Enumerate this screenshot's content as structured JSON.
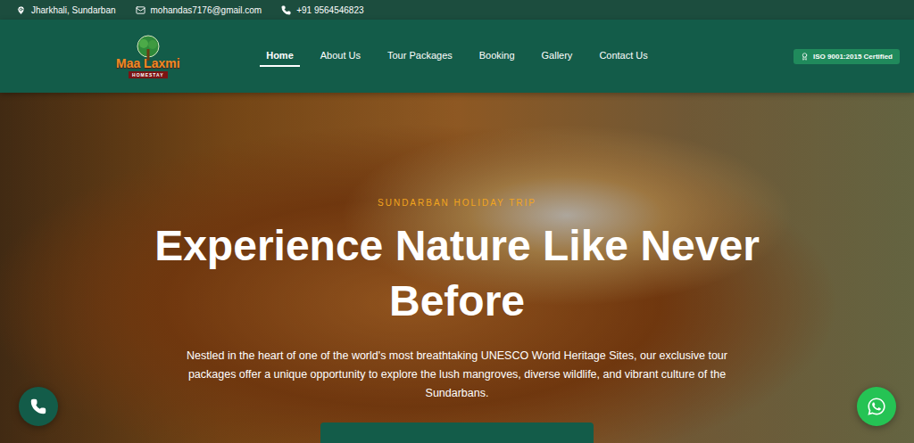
{
  "topbar": {
    "location": "Jharkhali, Sundarban",
    "email": "mohandas7176@gmail.com",
    "phone": "+91 9564546823"
  },
  "logo": {
    "name": "Maa Laxmi",
    "tagline": "HOMESTAY"
  },
  "nav": [
    {
      "label": "Home",
      "selected": true
    },
    {
      "label": "About Us",
      "selected": false
    },
    {
      "label": "Tour Packages",
      "selected": false
    },
    {
      "label": "Booking",
      "selected": false
    },
    {
      "label": "Gallery",
      "selected": false
    },
    {
      "label": "Contact Us",
      "selected": false
    }
  ],
  "badge": "ISO 9001:2015 Certified",
  "hero": {
    "eyebrow": "SUNDARBAN HOLIDAY TRIP",
    "title": "Experience Nature Like Never Before",
    "text": "Nestled in the heart of one of the world's most breathtaking UNESCO World Heritage Sites, our exclusive tour packages offer a unique opportunity to explore the lush mangroves, diverse wildlife, and vibrant culture of the Sundarbans."
  }
}
